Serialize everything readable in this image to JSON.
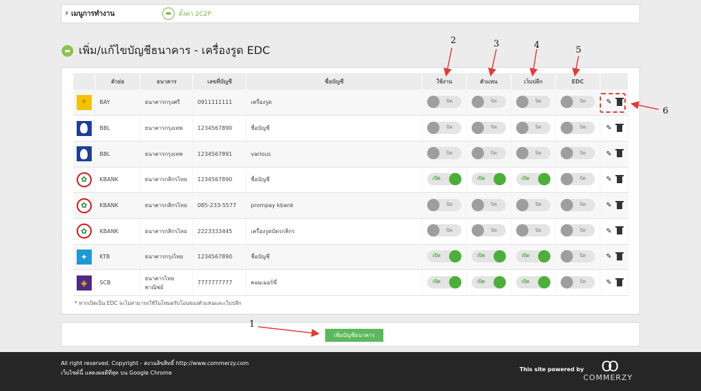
{
  "topbar": {
    "menu_label": "เมนูการทำงาน",
    "setting_label": "ตั้งค่า 2C2P",
    "bolt_icon": "bolt-icon",
    "setting_icon": "card-icon"
  },
  "page": {
    "title": "เพิ่ม/แก้ไขบัญชีธนาคาร - เครื่องรูด EDC",
    "title_icon": "bank-icon"
  },
  "table": {
    "headers": [
      "ตัวย่อ",
      "ธนาคาร",
      "เลขที่บัญชี",
      "ชื่อบัญชี",
      "ใช้งาน",
      "ตัวแทน",
      "เว็บปลีก",
      "EDC"
    ],
    "toggle_on_label": "เปิด",
    "toggle_off_label": "ปิด",
    "rows": [
      {
        "abbr": "BAY",
        "bank": "ธนาคารกรุงศรี",
        "account_no": "0911111111",
        "account_name": "เครื่องรูด",
        "logo": "bay-logo",
        "active": false,
        "agent": false,
        "web_retail": false,
        "edc": false
      },
      {
        "abbr": "BBL",
        "bank": "ธนาคารกรุงเทพ",
        "account_no": "1234567890",
        "account_name": "ชื่อบัญชี",
        "logo": "bbl-logo",
        "active": false,
        "agent": false,
        "web_retail": false,
        "edc": false
      },
      {
        "abbr": "BBL",
        "bank": "ธนาคารกรุงเทพ",
        "account_no": "1234567891",
        "account_name": "various",
        "logo": "bbl-logo",
        "active": false,
        "agent": false,
        "web_retail": false,
        "edc": false
      },
      {
        "abbr": "KBANK",
        "bank": "ธนาคารกสิกรไทย",
        "account_no": "1234567890",
        "account_name": "ชื่อบัญชี",
        "logo": "kbank-logo",
        "active": true,
        "agent": true,
        "web_retail": true,
        "edc": false
      },
      {
        "abbr": "KBANK",
        "bank": "ธนาคารกสิกรไทย",
        "account_no": "085-233-5577",
        "account_name": "prompay kbank",
        "logo": "kbank-logo",
        "active": false,
        "agent": false,
        "web_retail": false,
        "edc": false
      },
      {
        "abbr": "KBANK",
        "bank": "ธนาคารกสิกรไทย",
        "account_no": "2223333445",
        "account_name": "เครื่องรูดบัตรกสิกร",
        "logo": "kbank-logo",
        "active": false,
        "agent": false,
        "web_retail": false,
        "edc": false
      },
      {
        "abbr": "KTB",
        "bank": "ธนาคารกรุงไทย",
        "account_no": "1234567890",
        "account_name": "ชื่อบัญชี",
        "logo": "ktb-logo",
        "active": true,
        "agent": true,
        "web_retail": true,
        "edc": false
      },
      {
        "abbr": "SCB",
        "bank": "ธนาคารไทยพาณิชย์",
        "account_no": "7777777777",
        "account_name": "คอมเมอร์ซี่",
        "logo": "scb-logo",
        "active": true,
        "agent": true,
        "web_retail": true,
        "edc": false
      }
    ],
    "note": "* หากเปิดเป็น EDC จะไม่สามารถใช้ในโหมดรับโอนของตัวแทนและเว็บปลีก"
  },
  "add_button_label": "เพิ่มบัญชีธนาคาร",
  "annotations": [
    "1",
    "2",
    "3",
    "4",
    "5",
    "6"
  ],
  "annotation_color": "#e53935",
  "footer": {
    "copyright": "All right reserved. Copyright - สงวนลิขสิทธิ์ http://www.commerzy.com",
    "browser_note": "เว็บไซต์นี้ แสดงผลดีที่สุด บน Google Chrome",
    "powered_by": "This site powered by",
    "brand": "COMMERZY",
    "brand_icon": "infinity-icon"
  },
  "colors": {
    "accent_green": "#5cb85c",
    "toggle_on": "#4caf3a",
    "footer_bg": "#262626"
  }
}
